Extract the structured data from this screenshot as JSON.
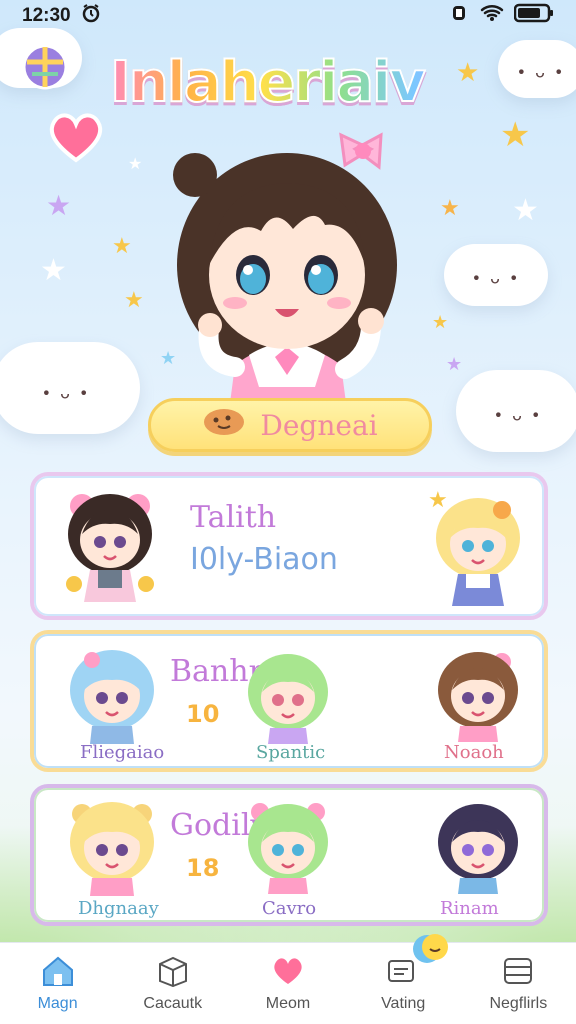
{
  "status_bar": {
    "time": "12:30"
  },
  "header": {
    "app_title": "Inlaheriaiv"
  },
  "hero": {
    "button_label": "Degneai"
  },
  "cards": [
    {
      "title": "Talith",
      "subtitle": "I0ly-Biaon"
    },
    {
      "title": "Banhr",
      "number": "10",
      "characters": [
        "Fliegaiao",
        "Spantic",
        "Noaoh"
      ]
    },
    {
      "title": "Godily",
      "number": "18",
      "characters": [
        "Dhgnaay",
        "Cavro",
        "Rinam"
      ]
    }
  ],
  "bottom_nav": {
    "items": [
      {
        "label": "Magn",
        "icon": "home-icon"
      },
      {
        "label": "Cacautk",
        "icon": "box-icon"
      },
      {
        "label": "Meom",
        "icon": "heart-icon"
      },
      {
        "label": "Vating",
        "icon": "chat-icon"
      },
      {
        "label": "Negflirls",
        "icon": "menu-icon"
      }
    ],
    "active_index": 0
  },
  "colors": {
    "accent_blue": "#3c8ed8",
    "button_yellow": "#ffe27a",
    "title_pink": "#c27ad9",
    "subtitle_blue": "#7aa6df"
  }
}
